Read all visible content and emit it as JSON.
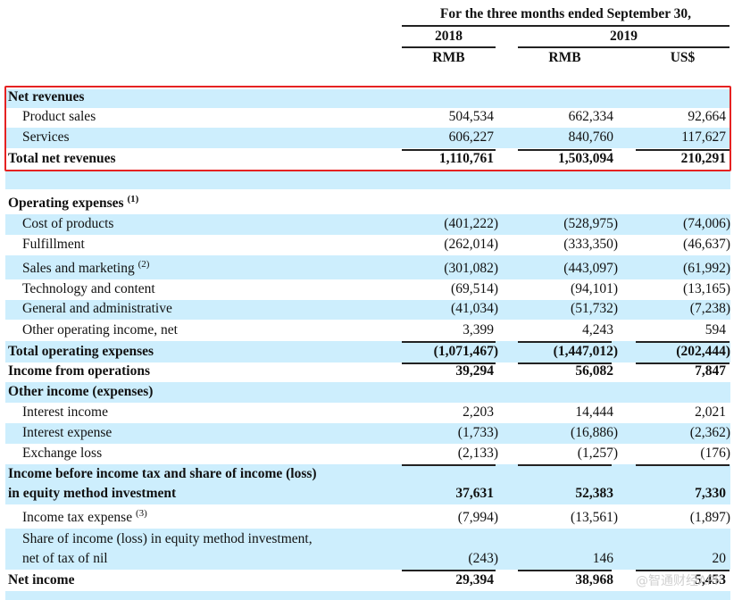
{
  "header": {
    "period": "For the three months ended September 30,",
    "years": [
      "2018",
      "2019"
    ],
    "currencies": [
      "RMB",
      "RMB",
      "US$"
    ]
  },
  "rows": [
    {
      "label": "Net revenues",
      "bold": true,
      "values": []
    },
    {
      "label": "Product sales",
      "values": [
        "504,534",
        "662,334",
        "92,664"
      ]
    },
    {
      "label": "Services",
      "values": [
        "606,227",
        "840,760",
        "117,627"
      ]
    },
    {
      "label": "Total net revenues",
      "bold": true,
      "values": [
        "1,110,761",
        "1,503,094",
        "210,291"
      ]
    },
    {
      "label": "",
      "values": []
    },
    {
      "label": "Operating expenses",
      "note": "(1)",
      "bold": true,
      "values": []
    },
    {
      "label": "Cost of products",
      "values": [
        "(401,222)",
        "(528,975)",
        "(74,006)"
      ]
    },
    {
      "label": "Fulfillment",
      "values": [
        "(262,014)",
        "(333,350)",
        "(46,637)"
      ]
    },
    {
      "label": "Sales and marketing",
      "note": "(2)",
      "values": [
        "(301,082)",
        "(443,097)",
        "(61,992)"
      ]
    },
    {
      "label": "Technology and content",
      "values": [
        "(69,514)",
        "(94,101)",
        "(13,165)"
      ]
    },
    {
      "label": "General and administrative",
      "values": [
        "(41,034)",
        "(51,732)",
        "(7,238)"
      ]
    },
    {
      "label": "Other operating income, net",
      "values": [
        "3,399",
        "4,243",
        "594"
      ]
    },
    {
      "label": "Total operating expenses",
      "bold": true,
      "values": [
        "(1,071,467)",
        "(1,447,012)",
        "(202,444)"
      ]
    },
    {
      "label": "Income from operations",
      "bold": true,
      "values": [
        "39,294",
        "56,082",
        "7,847"
      ]
    },
    {
      "label": "Other income (expenses)",
      "bold": true,
      "values": []
    },
    {
      "label": "Interest income",
      "values": [
        "2,203",
        "14,444",
        "2,021"
      ]
    },
    {
      "label": "Interest expense",
      "values": [
        "(1,733)",
        "(16,886)",
        "(2,362)"
      ]
    },
    {
      "label": "Exchange loss",
      "values": [
        "(2,133)",
        "(1,257)",
        "(176)"
      ]
    },
    {
      "label": "Income before income tax and share of income (loss)",
      "label2": "in equity method investment",
      "bold": true,
      "values": [
        "37,631",
        "52,383",
        "7,330"
      ]
    },
    {
      "label": "Income tax expense",
      "note": "(3)",
      "values": [
        "(7,994)",
        "(13,561)",
        "(1,897)"
      ]
    },
    {
      "label": "Share of income (loss) in equity method investment,",
      "label2": "net of tax of nil",
      "values": [
        "(243)",
        "146",
        "20"
      ]
    },
    {
      "label": "Net income",
      "bold": true,
      "values": [
        "29,394",
        "38,968",
        "5,453"
      ]
    }
  ],
  "watermark": "@智通财经APP",
  "highlight_color": "#e52222"
}
